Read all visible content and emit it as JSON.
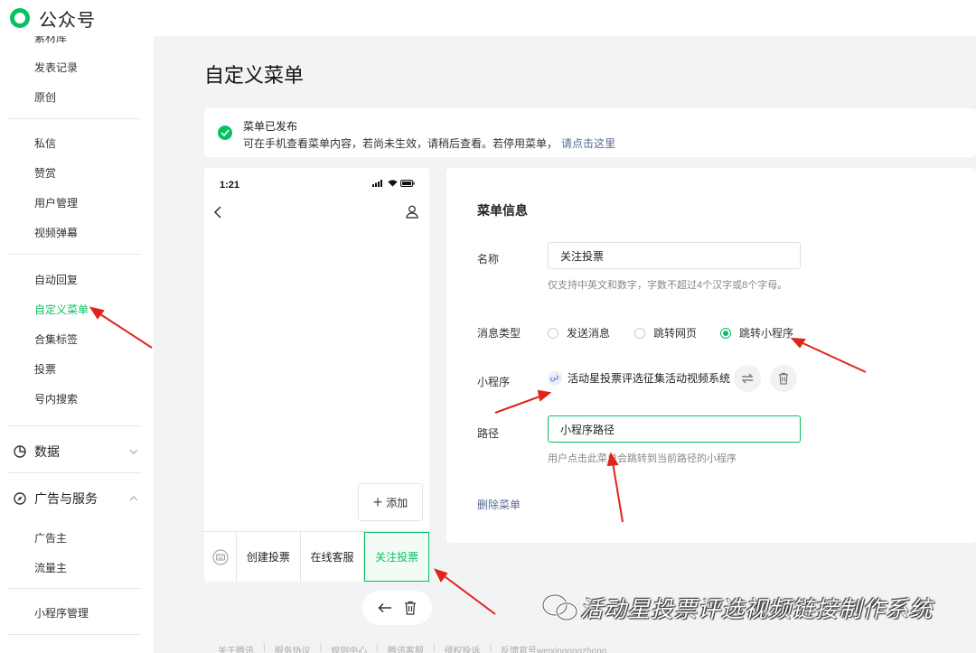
{
  "brand": {
    "name": "公众号"
  },
  "sidebar": {
    "cropped_top_item": "素材库",
    "items_a": [
      "发表记录",
      "原创"
    ],
    "items_b": [
      "私信",
      "赞赏",
      "用户管理",
      "视频弹幕"
    ],
    "items_c": [
      "自动回复",
      "自定义菜单",
      "合集标签",
      "投票",
      "号内搜索"
    ],
    "group_data": "数据",
    "group_ads": "广告与服务",
    "items_ads": [
      "广告主",
      "流量主"
    ],
    "item_mp": "小程序管理"
  },
  "page": {
    "title": "自定义菜单"
  },
  "notice": {
    "title": "菜单已发布",
    "body": "可在手机查看菜单内容，若尚未生效，请稍后查看。若停用菜单，",
    "link": "请点击这里"
  },
  "phone": {
    "time": "1:21",
    "add_label": "添加",
    "menus": [
      "创建投票",
      "在线客服",
      "关注投票"
    ],
    "active_menu_index": 2
  },
  "form": {
    "section_title": "菜单信息",
    "name_label": "名称",
    "name_value": "关注投票",
    "name_hint": "仅支持中英文和数字，字数不超过4个汉字或8个字母。",
    "type_label": "消息类型",
    "types": [
      "发送消息",
      "跳转网页",
      "跳转小程序"
    ],
    "selected_type_index": 2,
    "mp_label": "小程序",
    "mp_name": "活动星投票评选征集活动视频系统",
    "path_label": "路径",
    "path_value": "小程序路径",
    "path_hint": "用户点击此菜单会跳转到当前路径的小程序",
    "delete_label": "删除菜单"
  },
  "footer": {
    "links": [
      "关于腾讯",
      "服务协议",
      "规则中心",
      "腾讯客服",
      "侵权投诉",
      "反馈官号weixingongzhong"
    ]
  },
  "watermark": {
    "text": "活动星投票评选视频链接制作系统"
  },
  "colors": {
    "accent": "#07c160",
    "link": "#576b95",
    "annotation": "#e0241c"
  }
}
